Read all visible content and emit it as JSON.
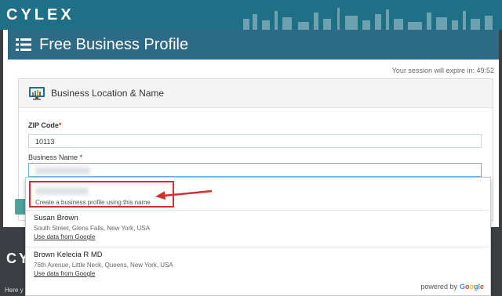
{
  "header": {
    "logo_text": "CYLEX"
  },
  "page": {
    "title": "Free Business Profile",
    "session_text": "Your session will expire in: 49:52"
  },
  "card": {
    "title": "Business Location & Name"
  },
  "form": {
    "zip_label": "ZIP Code",
    "zip_value": "10113",
    "name_label": "Business Name",
    "required_marker": "*"
  },
  "dropdown": {
    "create_profile_text": "Create a business profile using this name",
    "results": [
      {
        "name": "Susan Brown",
        "address": "South Street, Glens Falls, New York, USA",
        "action": "Use data from Google"
      },
      {
        "name": "Brown Kelecia R MD",
        "address": "76th Avenue, Little Neck, Queens, New York, USA",
        "action": "Use data from Google"
      }
    ],
    "powered_by": "powered by",
    "powered_brand": "Google"
  },
  "footer": {
    "logo_text": "CYLEX",
    "truncated_text": "Here y"
  },
  "colors": {
    "topbar": "#1f6f86",
    "titlebar": "#2d6a86",
    "annotation_red": "#d32f2f",
    "footer": "#3b3f44"
  }
}
